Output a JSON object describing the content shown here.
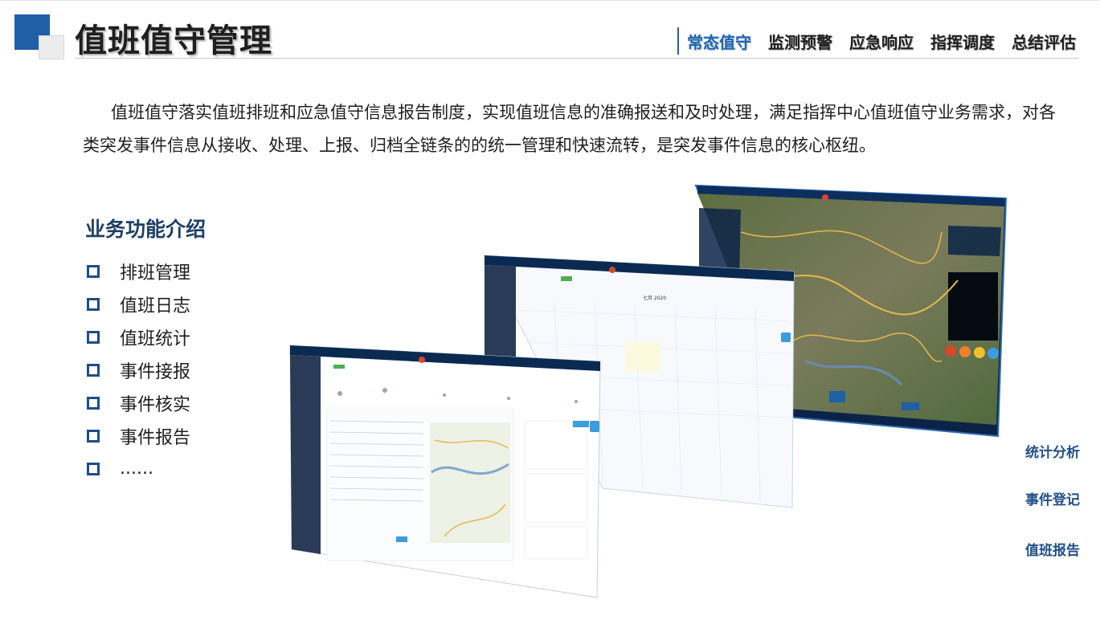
{
  "header": {
    "title": "值班值守管理",
    "nav": [
      {
        "label": "常态值守",
        "active": true
      },
      {
        "label": "监测预警",
        "active": false
      },
      {
        "label": "应急响应",
        "active": false
      },
      {
        "label": "指挥调度",
        "active": false
      },
      {
        "label": "总结评估",
        "active": false
      }
    ]
  },
  "intro": "值班值守落实值班排班和应急值守信息报告制度，实现值班信息的准确报送和及时处理，满足指挥中心值班值守业务需求，对各类突发事件信息从接收、处理、上报、归档全链条的的统一管理和快速流转，是突发事件信息的核心枢纽。",
  "features": {
    "title": "业务功能介绍",
    "items": [
      "排班管理",
      "值班日志",
      "值班统计",
      "事件接报",
      "事件核实",
      "事件报告",
      "......"
    ]
  },
  "side_links": [
    "统计分析",
    "事件登记",
    "值班报告"
  ],
  "screenshots": {
    "calendar_month": "七月 2020"
  },
  "colors": {
    "accent": "#1c66b8",
    "logo_blue": "#1f5fa6",
    "section_title": "#1f3e64",
    "dark_panel": "#0b2346",
    "sidebar": "#2a3b57"
  }
}
